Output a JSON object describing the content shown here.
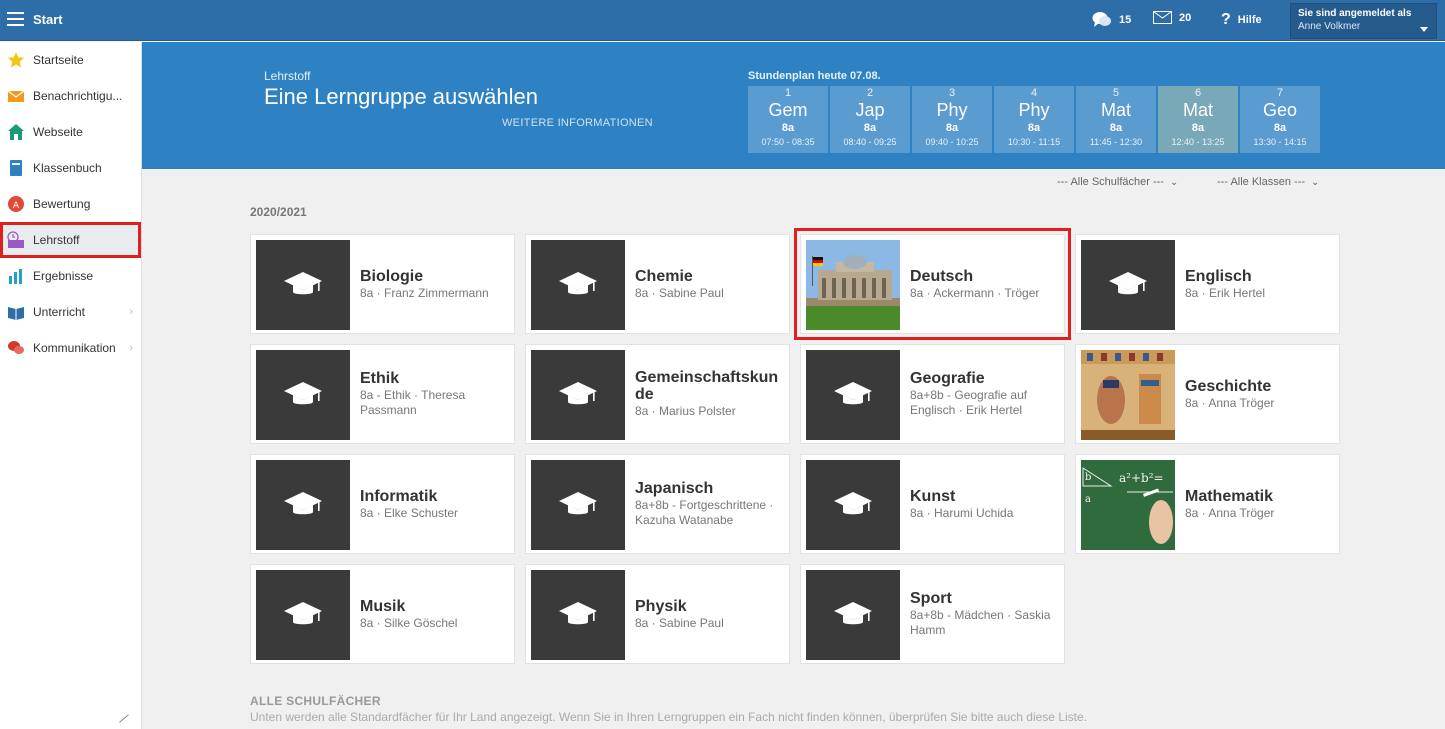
{
  "topbar": {
    "title": "Start",
    "messages_count": "15",
    "mail_count": "20",
    "help_label": "Hilfe",
    "user_caption": "Sie sind angemeldet als",
    "user_name": "Anne Volkmer"
  },
  "sidebar": {
    "items": [
      {
        "label": "Startseite",
        "icon": "star-icon"
      },
      {
        "label": "Benachrichtigu...",
        "icon": "envelope-icon"
      },
      {
        "label": "Webseite",
        "icon": "house-icon"
      },
      {
        "label": "Klassenbuch",
        "icon": "book-icon"
      },
      {
        "label": "Bewertung",
        "icon": "grade-icon"
      },
      {
        "label": "Lehrstoff",
        "icon": "lesson-material-icon"
      },
      {
        "label": "Ergebnisse",
        "icon": "bar-chart-icon"
      },
      {
        "label": "Unterricht",
        "icon": "open-book-icon"
      },
      {
        "label": "Kommunikation",
        "icon": "chat-icon"
      }
    ]
  },
  "banner": {
    "crumb": "Lehrstoff",
    "title": "Eine Lerngruppe auswählen",
    "more_link": "WEITERE INFORMATIONEN",
    "schedule_title": "Stundenplan heute 07.08.",
    "lessons": [
      {
        "num": "1",
        "subject": "Gem",
        "class": "8a",
        "time": "07:50 - 08:35"
      },
      {
        "num": "2",
        "subject": "Jap",
        "class": "8a",
        "time": "08:40 - 09:25"
      },
      {
        "num": "3",
        "subject": "Phy",
        "class": "8a",
        "time": "09:40 - 10:25"
      },
      {
        "num": "4",
        "subject": "Phy",
        "class": "8a",
        "time": "10:30 - 11:15"
      },
      {
        "num": "5",
        "subject": "Mat",
        "class": "8a",
        "time": "11:45 - 12:30"
      },
      {
        "num": "6",
        "subject": "Mat",
        "class": "8a",
        "time": "12:40 - 13:25"
      },
      {
        "num": "7",
        "subject": "Geo",
        "class": "8a",
        "time": "13:30 - 14:15"
      }
    ]
  },
  "filters": {
    "subjects": "--- Alle Schulfächer ---",
    "classes": "--- Alle Klassen ---"
  },
  "year": "2020/2021",
  "cards": [
    {
      "name": "Biologie",
      "sub": "8a · Franz Zimmermann",
      "thumb": "cap"
    },
    {
      "name": "Chemie",
      "sub": "8a · Sabine Paul",
      "thumb": "cap"
    },
    {
      "name": "Deutsch",
      "sub": "8a · Ackermann · Tröger",
      "thumb": "reichstag"
    },
    {
      "name": "Englisch",
      "sub": "8a · Erik Hertel",
      "thumb": "cap"
    },
    {
      "name": "Ethik",
      "sub": "8a - Ethik · Theresa Passmann",
      "thumb": "cap"
    },
    {
      "name": "Gemeinschaftskunde",
      "sub": "8a · Marius Polster",
      "thumb": "cap"
    },
    {
      "name": "Geografie",
      "sub": "8a+8b - Geografie auf Englisch · Erik Hertel",
      "thumb": "cap"
    },
    {
      "name": "Geschichte",
      "sub": "8a · Anna Tröger",
      "thumb": "egypt"
    },
    {
      "name": "Informatik",
      "sub": "8a · Elke Schuster",
      "thumb": "cap"
    },
    {
      "name": "Japanisch",
      "sub": "8a+8b - Fortgeschrittene · Kazuha Watanabe",
      "thumb": "cap"
    },
    {
      "name": "Kunst",
      "sub": "8a · Harumi Uchida",
      "thumb": "cap"
    },
    {
      "name": "Mathematik",
      "sub": "8a · Anna Tröger",
      "thumb": "chalkboard"
    },
    {
      "name": "Musik",
      "sub": "8a · Silke Göschel",
      "thumb": "cap"
    },
    {
      "name": "Physik",
      "sub": "8a · Sabine Paul",
      "thumb": "cap"
    },
    {
      "name": "Sport",
      "sub": "8a+8b - Mädchen · Saskia Hamm",
      "thumb": "cap"
    }
  ],
  "all_subjects": {
    "title": "ALLE SCHULFÄCHER",
    "desc": "Unten werden alle Standardfächer für Ihr Land angezeigt. Wenn Sie in Ihren Lerngruppen ein Fach nicht finden können, überprüfen Sie bitte auch diese Liste."
  },
  "colors": {
    "topbar": "#2d6ea8",
    "banner": "#2e82c4",
    "lesson": "#5a9bd0",
    "lesson_current": "#79a8b8",
    "highlight": "#e02020"
  }
}
